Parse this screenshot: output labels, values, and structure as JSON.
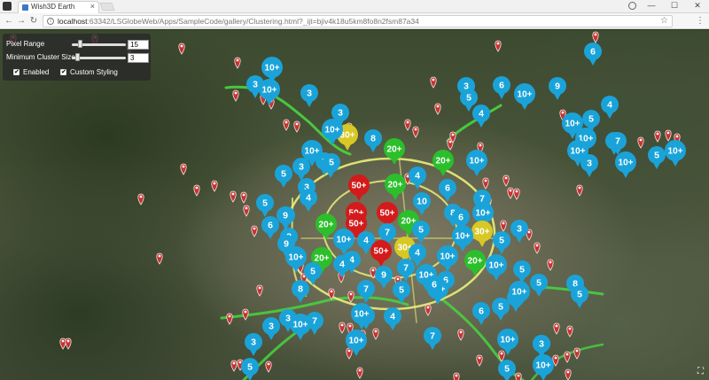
{
  "browser": {
    "tab_title": "Wish3D Earth",
    "tab_close": "×",
    "url_host": "localhost",
    "url_rest": ":63342/LSGlobeWeb/Apps/SampleCode/gallery/Clustering.html?_ijt=bjiv4k18u5km8fo8n2fsm87a34",
    "window_controls": [
      "—",
      "☐",
      "✕"
    ],
    "nav": {
      "back": "←",
      "forward": "→",
      "reload": "↻"
    },
    "icons": [
      "back-icon",
      "forward-icon",
      "reload-icon",
      "info-icon",
      "star-icon",
      "menu-icon",
      "profile-icon",
      "fullscreen-icon"
    ]
  },
  "controls": {
    "pixel_range_label": "Pixel Range",
    "pixel_range_value": "15",
    "pixel_range_level": 0.15,
    "min_cluster_label": "Minimum Cluster Size",
    "min_cluster_value": "3",
    "min_cluster_level": 0.1,
    "enabled_label": "Enabled",
    "enabled_checked": true,
    "custom_styling_label": "Custom Styling",
    "custom_styling_checked": true
  },
  "legend_colors": {
    "blue": "#1aa3d9",
    "green": "#2bbf2b",
    "yellow": "#d8c825",
    "red": "#d41a1a",
    "pin": "#c8322e"
  },
  "clusters": [
    {
      "t": "10+",
      "c": "blue"
    },
    {
      "t": "3",
      "c": "blue"
    },
    {
      "t": "10+",
      "c": "blue"
    },
    {
      "t": "3",
      "c": "blue"
    },
    {
      "t": "6",
      "c": "blue"
    },
    {
      "t": "10+",
      "c": "blue"
    },
    {
      "t": "3",
      "c": "blue"
    },
    {
      "t": "30+",
      "c": "yellow"
    },
    {
      "t": "8",
      "c": "blue"
    },
    {
      "t": "9",
      "c": "blue"
    },
    {
      "t": "6",
      "c": "blue"
    },
    {
      "t": "10+",
      "c": "blue"
    },
    {
      "t": "10+",
      "c": "blue"
    },
    {
      "t": "20+",
      "c": "green"
    },
    {
      "t": "20+",
      "c": "green"
    },
    {
      "t": "10+",
      "c": "blue"
    },
    {
      "t": "4",
      "c": "blue"
    },
    {
      "t": "50+",
      "c": "red"
    },
    {
      "t": "20+",
      "c": "green"
    },
    {
      "t": "5",
      "c": "blue"
    },
    {
      "t": "5",
      "c": "blue"
    },
    {
      "t": "50+",
      "c": "red"
    },
    {
      "t": "50+",
      "c": "red"
    },
    {
      "t": "10",
      "c": "blue"
    },
    {
      "t": "6",
      "c": "blue"
    },
    {
      "t": "7",
      "c": "blue"
    },
    {
      "t": "9",
      "c": "blue"
    },
    {
      "t": "20+",
      "c": "green"
    },
    {
      "t": "20+",
      "c": "green"
    },
    {
      "t": "50+",
      "c": "red"
    },
    {
      "t": "8",
      "c": "blue"
    },
    {
      "t": "10+",
      "c": "blue"
    },
    {
      "t": "8",
      "c": "blue"
    },
    {
      "t": "4",
      "c": "blue"
    },
    {
      "t": "7",
      "c": "blue"
    },
    {
      "t": "5",
      "c": "blue"
    },
    {
      "t": "10+",
      "c": "blue"
    },
    {
      "t": "30+",
      "c": "yellow"
    },
    {
      "t": "3",
      "c": "blue"
    },
    {
      "t": "5",
      "c": "blue"
    },
    {
      "t": "50+",
      "c": "red"
    },
    {
      "t": "30+",
      "c": "yellow"
    },
    {
      "t": "20+",
      "c": "green"
    },
    {
      "t": "10+",
      "c": "blue"
    },
    {
      "t": "5",
      "c": "blue"
    },
    {
      "t": "4",
      "c": "blue"
    },
    {
      "t": "9",
      "c": "blue"
    },
    {
      "t": "7",
      "c": "blue"
    },
    {
      "t": "10+",
      "c": "blue"
    },
    {
      "t": "20+",
      "c": "green"
    },
    {
      "t": "7",
      "c": "blue"
    },
    {
      "t": "5",
      "c": "blue"
    },
    {
      "t": "8",
      "c": "blue"
    },
    {
      "t": "6",
      "c": "blue"
    },
    {
      "t": "10+",
      "c": "blue"
    },
    {
      "t": "5",
      "c": "blue"
    },
    {
      "t": "5",
      "c": "blue"
    },
    {
      "t": "10+",
      "c": "blue"
    },
    {
      "t": "7",
      "c": "blue"
    },
    {
      "t": "4",
      "c": "blue"
    },
    {
      "t": "6",
      "c": "blue"
    },
    {
      "t": "5",
      "c": "blue"
    },
    {
      "t": "5",
      "c": "blue"
    },
    {
      "t": "8",
      "c": "blue"
    },
    {
      "t": "6",
      "c": "blue"
    },
    {
      "t": "5",
      "c": "blue"
    },
    {
      "t": "3",
      "c": "blue"
    },
    {
      "t": "7",
      "c": "blue"
    },
    {
      "t": "10+",
      "c": "blue"
    },
    {
      "t": "3",
      "c": "blue"
    },
    {
      "t": "7",
      "c": "blue"
    },
    {
      "t": "10+",
      "c": "blue"
    },
    {
      "t": "4",
      "c": "blue"
    },
    {
      "t": "6",
      "c": "blue"
    },
    {
      "t": "10+",
      "c": "blue"
    },
    {
      "t": "3",
      "c": "blue"
    },
    {
      "t": "5",
      "c": "blue"
    },
    {
      "t": "10+",
      "c": "blue"
    },
    {
      "t": "4",
      "c": "blue"
    },
    {
      "t": "7",
      "c": "blue"
    },
    {
      "t": "10+",
      "c": "blue"
    },
    {
      "t": "5",
      "c": "blue"
    },
    {
      "t": "10+",
      "c": "blue"
    },
    {
      "t": "4",
      "c": "blue"
    },
    {
      "t": "10+",
      "c": "blue"
    },
    {
      "t": "6",
      "c": "blue"
    },
    {
      "t": "10+",
      "c": "blue"
    },
    {
      "t": "3",
      "c": "blue"
    },
    {
      "t": "10+",
      "c": "blue"
    },
    {
      "t": "5",
      "c": "blue"
    },
    {
      "t": "10+",
      "c": "blue"
    },
    {
      "t": "7",
      "c": "blue"
    },
    {
      "t": "3",
      "c": "blue"
    },
    {
      "t": "3",
      "c": "blue"
    },
    {
      "t": "10+",
      "c": "blue"
    },
    {
      "t": "10+",
      "c": "blue"
    },
    {
      "t": "5",
      "c": "blue"
    },
    {
      "t": "5",
      "c": "blue"
    },
    {
      "t": "3",
      "c": "blue"
    },
    {
      "t": "8",
      "c": "blue"
    },
    {
      "t": "3",
      "c": "blue"
    },
    {
      "t": "4",
      "c": "blue"
    },
    {
      "t": "5",
      "c": "blue"
    },
    {
      "t": "9",
      "c": "blue"
    },
    {
      "t": "10+",
      "c": "blue"
    },
    {
      "t": "6",
      "c": "blue"
    },
    {
      "t": "5",
      "c": "blue"
    },
    {
      "t": "5",
      "c": "blue"
    },
    {
      "t": "4",
      "c": "blue"
    }
  ]
}
